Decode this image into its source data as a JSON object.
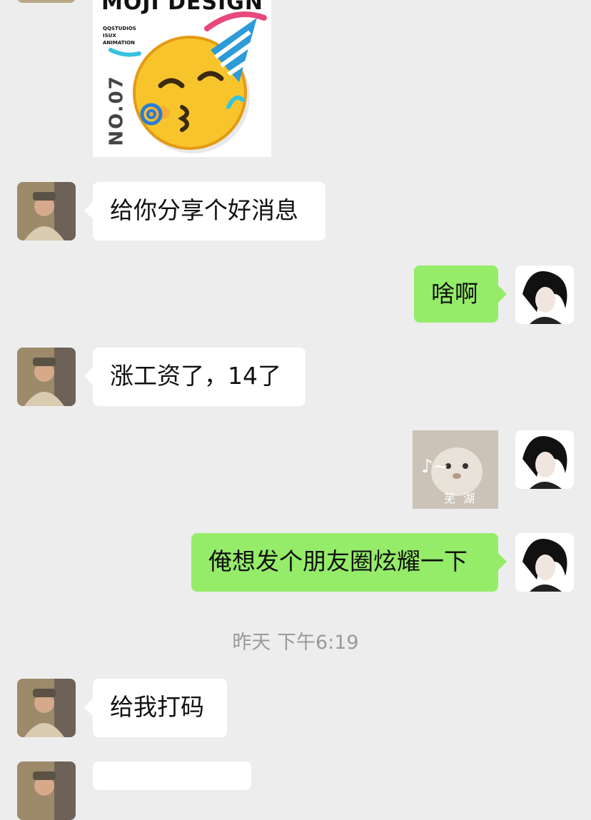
{
  "sticker": {
    "title": "MOJI DESIGN",
    "line1": "QQSTUDIOS",
    "line2": "ISUX",
    "line3": "ANIMATION",
    "side": "NO.07"
  },
  "messages": [
    {
      "text": "给你分享个好消息"
    },
    {
      "text": "啥啊"
    },
    {
      "text": "涨工资了，14了"
    },
    {
      "text": "俺想发个朋友圈炫耀一下"
    },
    {
      "text": "给我打码"
    }
  ],
  "music": {
    "note": "♪~",
    "label": "芜 湖"
  },
  "timestamp": "昨天 下午6:19",
  "colors": {
    "background": "#ededed",
    "incoming": "#ffffff",
    "outgoing": "#95ec69",
    "timestamp": "#9a9a9a"
  }
}
